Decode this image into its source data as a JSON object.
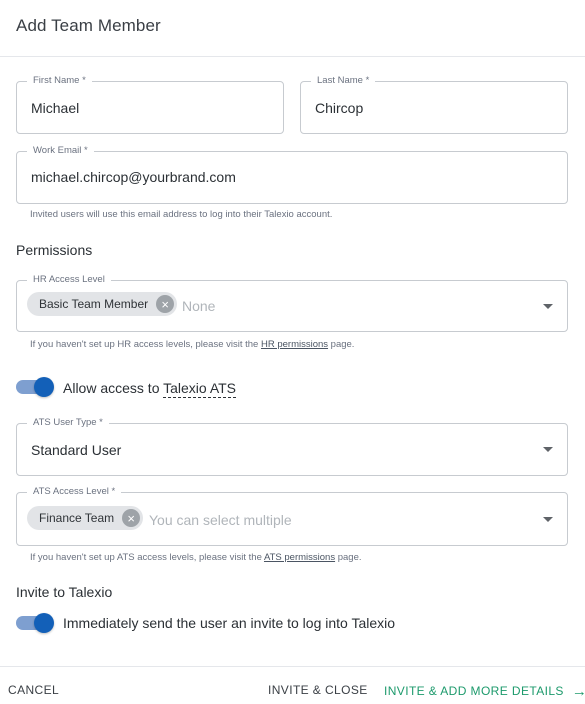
{
  "dialog": {
    "title": "Add Team Member"
  },
  "form": {
    "first_name": {
      "label": "First Name *",
      "value": "Michael"
    },
    "last_name": {
      "label": "Last Name *",
      "value": "Chircop"
    },
    "work_email": {
      "label": "Work Email *",
      "value": "michael.chircop@yourbrand.com",
      "helper": "Invited users will use this email address to log into their Talexio account."
    }
  },
  "permissions": {
    "title": "Permissions",
    "hr_access": {
      "label": "HR Access Level",
      "chip": "Basic Team Member",
      "placeholder": "None",
      "helper_prefix": "If you haven't set up HR access levels, please visit the ",
      "helper_link": "HR permissions",
      "helper_suffix": " page."
    },
    "ats_toggle": {
      "prefix": "Allow access to ",
      "link": "Talexio ATS",
      "on": true
    },
    "ats_user_type": {
      "label": "ATS User Type *",
      "value": "Standard User"
    },
    "ats_access": {
      "label": "ATS Access Level *",
      "chip": "Finance Team",
      "placeholder": "You can select multiple",
      "helper_prefix": "If you haven't set up ATS access levels, please visit the ",
      "helper_link": "ATS permissions",
      "helper_suffix": " page."
    }
  },
  "invite": {
    "title": "Invite to Talexio",
    "toggle_label": "Immediately send the user an invite to log into Talexio",
    "on": true
  },
  "footer": {
    "cancel": "CANCEL",
    "invite_close": "INVITE & CLOSE",
    "invite_more": "INVITE & ADD MORE DETAILS",
    "arrow_icon": "→"
  },
  "colors": {
    "accent": "#1360b8",
    "primary_action": "#1d9a6c",
    "toggle_track": "#7e9fd0"
  }
}
